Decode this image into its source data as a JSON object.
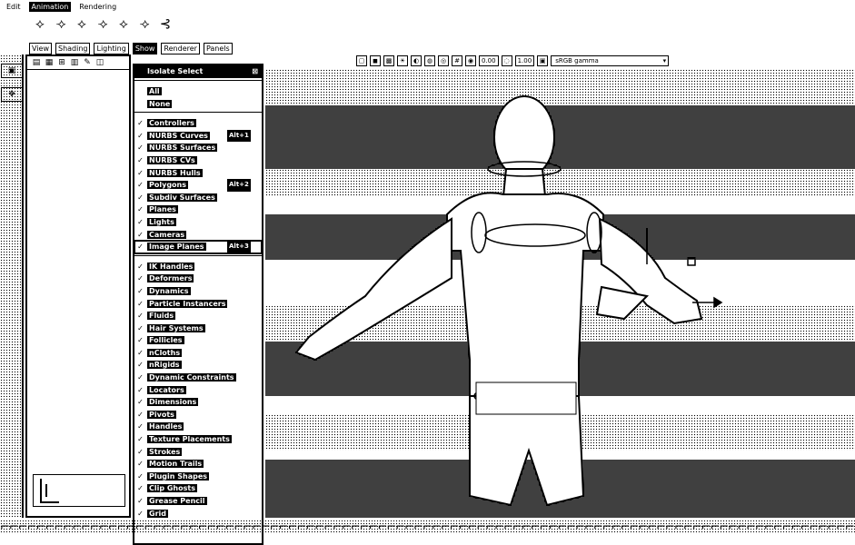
{
  "menubar": {
    "items": [
      {
        "label": "Edit",
        "active": false
      },
      {
        "label": "Animation",
        "active": true
      },
      {
        "label": "Rendering",
        "active": false
      }
    ]
  },
  "panel_menus": [
    {
      "label": "View",
      "open": false
    },
    {
      "label": "Shading",
      "open": false
    },
    {
      "label": "Lighting",
      "open": false
    },
    {
      "label": "Show",
      "open": true
    },
    {
      "label": "Renderer",
      "open": false
    },
    {
      "label": "Panels",
      "open": false
    }
  ],
  "show_menu": {
    "title": "Isolate Select",
    "items_top": [
      {
        "label": "All",
        "checked": false
      },
      {
        "label": "None",
        "checked": false
      }
    ],
    "items": [
      {
        "label": "Controllers",
        "checked": true,
        "hotkey": ""
      },
      {
        "label": "NURBS Curves",
        "checked": true,
        "hotkey": "Alt+1"
      },
      {
        "label": "NURBS Surfaces",
        "checked": true,
        "hotkey": ""
      },
      {
        "label": "NURBS CVs",
        "checked": true,
        "hotkey": ""
      },
      {
        "label": "NURBS Hulls",
        "checked": true,
        "hotkey": ""
      },
      {
        "label": "Polygons",
        "checked": true,
        "hotkey": "Alt+2"
      },
      {
        "label": "Subdiv Surfaces",
        "checked": true,
        "hotkey": ""
      },
      {
        "label": "Planes",
        "checked": true,
        "hotkey": ""
      },
      {
        "label": "Lights",
        "checked": true,
        "hotkey": ""
      },
      {
        "label": "Cameras",
        "checked": true,
        "hotkey": ""
      },
      {
        "label": "Image Planes",
        "checked": true,
        "hotkey": "Alt+3",
        "highlighted": true
      }
    ],
    "items_bottom": [
      {
        "label": "IK Handles",
        "checked": true
      },
      {
        "label": "Deformers",
        "checked": true
      },
      {
        "label": "Dynamics",
        "checked": true
      },
      {
        "label": "Particle Instancers",
        "checked": true
      },
      {
        "label": "Fluids",
        "checked": true
      },
      {
        "label": "Hair Systems",
        "checked": true
      },
      {
        "label": "Follicles",
        "checked": true
      },
      {
        "label": "nCloths",
        "checked": true
      },
      {
        "label": "nRigids",
        "checked": true
      },
      {
        "label": "Dynamic Constraints",
        "checked": true
      },
      {
        "label": "Locators",
        "checked": true
      },
      {
        "label": "Dimensions",
        "checked": true
      },
      {
        "label": "Pivots",
        "checked": true
      },
      {
        "label": "Handles",
        "checked": true
      },
      {
        "label": "Texture Placements",
        "checked": true
      },
      {
        "label": "Strokes",
        "checked": true
      },
      {
        "label": "Motion Trails",
        "checked": true
      },
      {
        "label": "Plugin Shapes",
        "checked": true
      },
      {
        "label": "Clip Ghosts",
        "checked": true
      },
      {
        "label": "Grease Pencil",
        "checked": true
      },
      {
        "label": "Grid",
        "checked": true
      }
    ]
  },
  "viewport_toolbar": {
    "field_a": "0.00",
    "field_b": "1.00",
    "colorspace": "sRGB gamma"
  }
}
